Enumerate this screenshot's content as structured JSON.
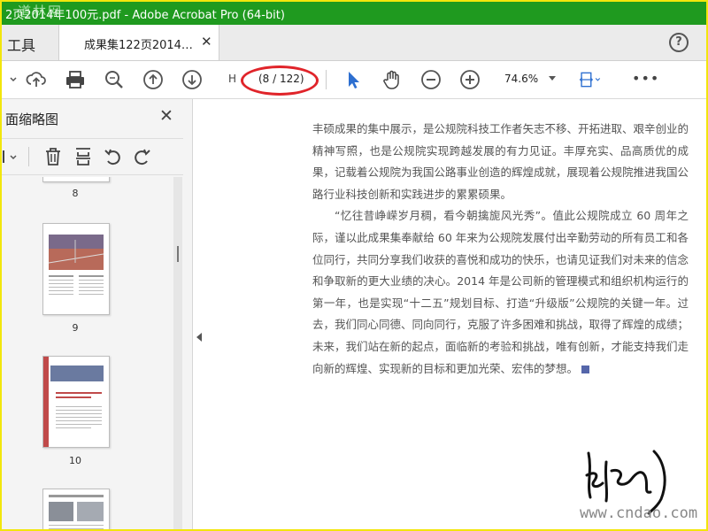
{
  "window": {
    "title": "2页2014年100元.pdf - Adobe Acrobat Pro (64-bit)",
    "watermark_top": "道林网",
    "titlebar_color": "#1f9a1f"
  },
  "tabs": {
    "tools_label": "工具",
    "document_label": "成果集122页2014…",
    "close_glyph": "✕",
    "help_glyph": "?"
  },
  "toolbar": {
    "page_prefix": "H",
    "page_indicator": "(8 / 122)",
    "zoom_value": "74.6%",
    "icons": [
      "upload-icon",
      "print-icon",
      "zoom-search-icon",
      "page-up-icon",
      "page-down-icon",
      "select-arrow-icon",
      "hand-icon",
      "zoom-out-icon",
      "zoom-in-icon",
      "fit-width-icon",
      "more-icon"
    ],
    "highlight_color": "#e0242a"
  },
  "left_panel": {
    "title": "面缩略图",
    "close_glyph": "✕",
    "thumbnails": [
      {
        "label": "8"
      },
      {
        "label": "9"
      },
      {
        "label": "10"
      }
    ]
  },
  "document": {
    "paragraph1": "丰硕成果的集中展示，是公规院科技工作者矢志不移、开拓进取、艰辛创业的精神写照，也是公规院实现跨越发展的有力见证。丰厚充实、品高质优的成果，记载着公规院为我国公路事业创造的辉煌成就，展现着公规院推进我国公路行业科技创新和实践进步的累累硕果。",
    "paragraph2": "“忆往昔峥嵘岁月稠，看今朝擒旎风光秀”。值此公规院成立 60 周年之际，谨以此成果集奉献给 60 年来为公规院发展付出辛勤劳动的所有员工和各位同行，共同分享我们收获的喜悦和成功的快乐，也请见证我们对未来的信念和争取新的更大业绩的决心。2014 年是公司新的管理模式和组织机构运行的第一年，也是实现“十二五”规划目标、打造“升级版”公规院的关键一年。过去，我们同心同德、同向同行，克服了许多困难和挑战，取得了辉煌的成绩；未来，我们站在新的起点，面临新的考验和挑战，唯有创新，才能支持我们走向新的辉煌、实现新的目标和更加光荣、宏伟的梦想。",
    "watermark_bottom": "www.cndao.com"
  }
}
